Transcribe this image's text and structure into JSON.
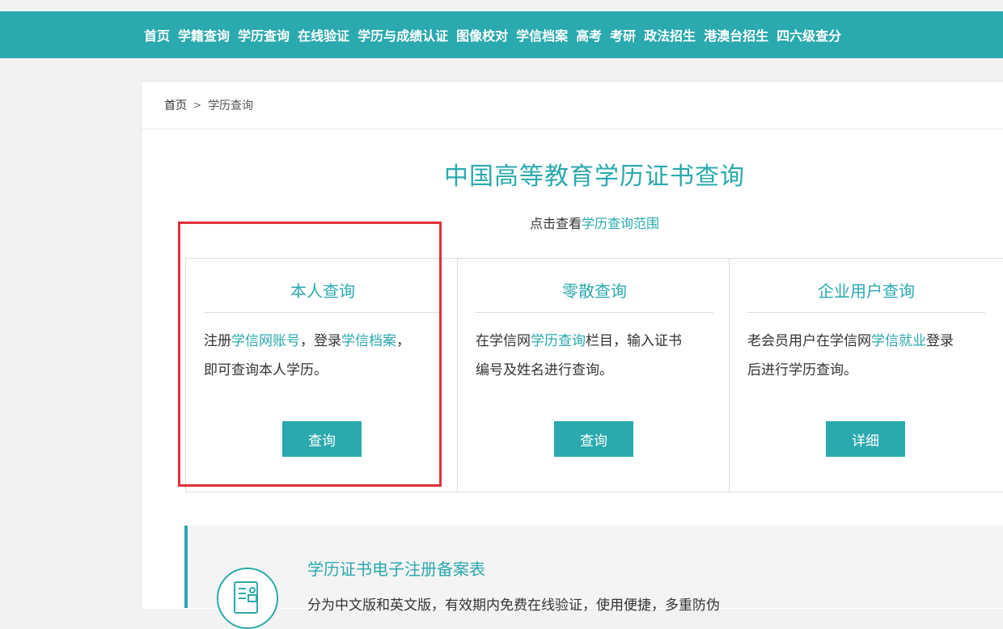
{
  "nav": {
    "items": [
      "首页",
      "学籍查询",
      "学历查询",
      "在线验证",
      "学历与成绩认证",
      "图像校对",
      "学信档案",
      "高考",
      "考研",
      "政法招生",
      "港澳台招生",
      "四六级查分"
    ]
  },
  "breadcrumb": {
    "home": "首页",
    "separator": ">",
    "current": "学历查询"
  },
  "page": {
    "title": "中国高等教育学历证书查询",
    "range_prefix": "点击查看",
    "range_link": "学历查询范围"
  },
  "cards": [
    {
      "title": "本人查询",
      "desc": [
        {
          "text": "注册",
          "link": false
        },
        {
          "text": "学信网账号",
          "link": true
        },
        {
          "text": "，登录",
          "link": false
        },
        {
          "text": "学信档案",
          "link": true
        },
        {
          "text": "，即可查询本人学历。",
          "link": false
        }
      ],
      "button": "查询"
    },
    {
      "title": "零散查询",
      "desc": [
        {
          "text": "在学信网",
          "link": false
        },
        {
          "text": "学历查询",
          "link": true
        },
        {
          "text": "栏目，输入证书编号及姓名进行查询。",
          "link": false
        }
      ],
      "button": "查询"
    },
    {
      "title": "企业用户查询",
      "desc": [
        {
          "text": "老会员用户在学信网",
          "link": false
        },
        {
          "text": "学信就业",
          "link": true
        },
        {
          "text": "登录后进行学历查询。",
          "link": false
        }
      ],
      "button": "详细"
    }
  ],
  "bottom": {
    "title": "学历证书电子注册备案表",
    "desc": "分为中文版和英文版，有效期内免费在线验证，使用便捷，多重防伪"
  },
  "colors": {
    "accent": "#2aa9ae",
    "highlight": "#e0303a"
  }
}
